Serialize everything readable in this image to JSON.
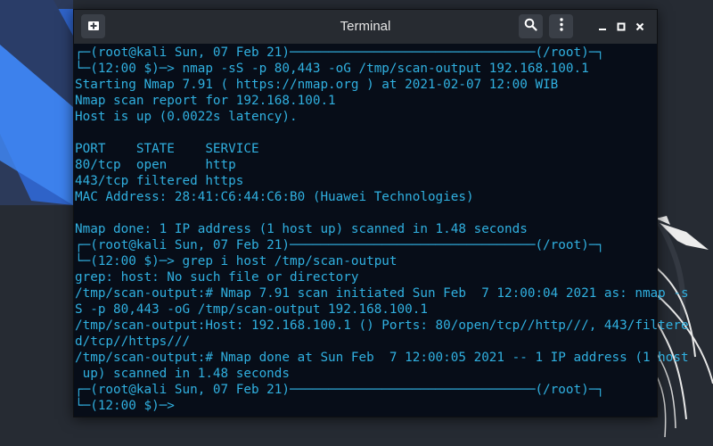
{
  "window": {
    "title": "Terminal",
    "buttons": {
      "new_tab_icon": "new-tab-icon",
      "search_icon": "search-icon",
      "menu_icon": "vertical-dots-icon"
    },
    "controls": {
      "minimize": "minimize-icon",
      "maximize": "maximize-icon",
      "close": "close-icon"
    }
  },
  "colors": {
    "terminal_text": "#30b0e0",
    "terminal_bg": "#050a16",
    "titlebar": "#272b31",
    "desktop_bg": "#262b33",
    "accent_blue": "#367bf0"
  },
  "terminal": {
    "lines": [
      "┌─(root@kali Sun, 07 Feb 21)────────────────────────────────(/root)─┐",
      "└─(12:00 $)─> nmap -sS -p 80,443 -oG /tmp/scan-output 192.168.100.1",
      "Starting Nmap 7.91 ( https://nmap.org ) at 2021-02-07 12:00 WIB",
      "Nmap scan report for 192.168.100.1",
      "Host is up (0.0022s latency).",
      "",
      "PORT    STATE    SERVICE",
      "80/tcp  open     http",
      "443/tcp filtered https",
      "MAC Address: 28:41:C6:44:C6:B0 (Huawei Technologies)",
      "",
      "Nmap done: 1 IP address (1 host up) scanned in 1.48 seconds",
      "┌─(root@kali Sun, 07 Feb 21)────────────────────────────────(/root)─┐",
      "└─(12:00 $)─> grep i host /tmp/scan-output",
      "grep: host: No such file or directory",
      "/tmp/scan-output:# Nmap 7.91 scan initiated Sun Feb  7 12:00:04 2021 as: nmap -s",
      "S -p 80,443 -oG /tmp/scan-output 192.168.100.1",
      "/tmp/scan-output:Host: 192.168.100.1 () Ports: 80/open/tcp//http///, 443/filtere",
      "d/tcp//https///",
      "/tmp/scan-output:# Nmap done at Sun Feb  7 12:00:05 2021 -- 1 IP address (1 host",
      " up) scanned in 1.48 seconds",
      "┌─(root@kali Sun, 07 Feb 21)────────────────────────────────(/root)─┐",
      "└─(12:00 $)─>"
    ]
  }
}
